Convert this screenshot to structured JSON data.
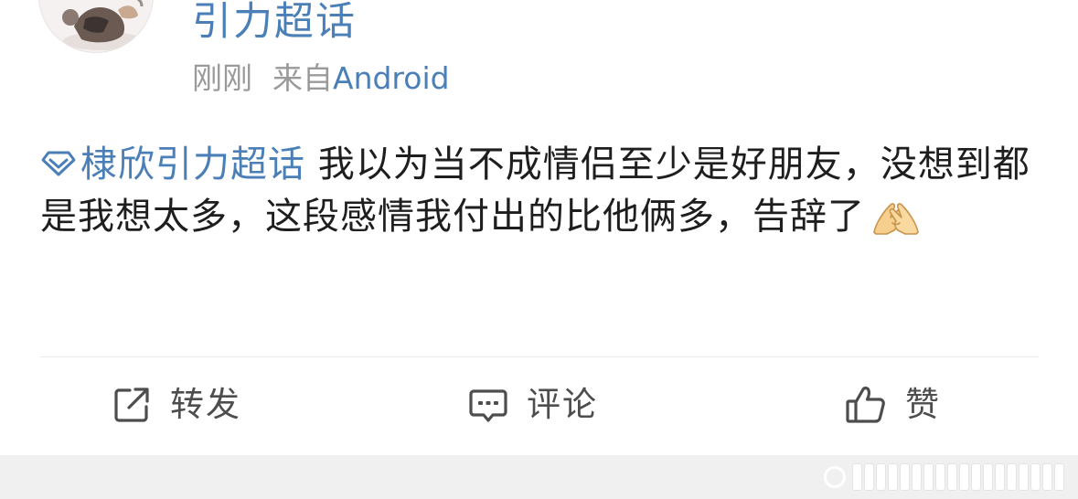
{
  "post": {
    "author": {
      "name": "引力超话"
    },
    "meta": {
      "time": "刚刚",
      "source_prefix": "来自",
      "source_name": "Android"
    },
    "topic": {
      "name": "棣欣引力超话",
      "icon": "diamond-icon"
    },
    "text": " 我以为当不成情侣至少是好朋友，没想到都是我想太多，这段感情我付出的比他俩多，告辞了",
    "emoji": "folded-hands-emoji"
  },
  "actions": {
    "repost": {
      "label": "转发",
      "icon": "share-icon"
    },
    "comment": {
      "label": "评论",
      "icon": "comment-icon"
    },
    "like": {
      "label": "赞",
      "icon": "thumbs-up-icon"
    }
  },
  "colors": {
    "link": "#4a7fb8",
    "text": "#1e1e1e",
    "meta": "#9a9a9a",
    "action_text": "#4d4d4d"
  }
}
